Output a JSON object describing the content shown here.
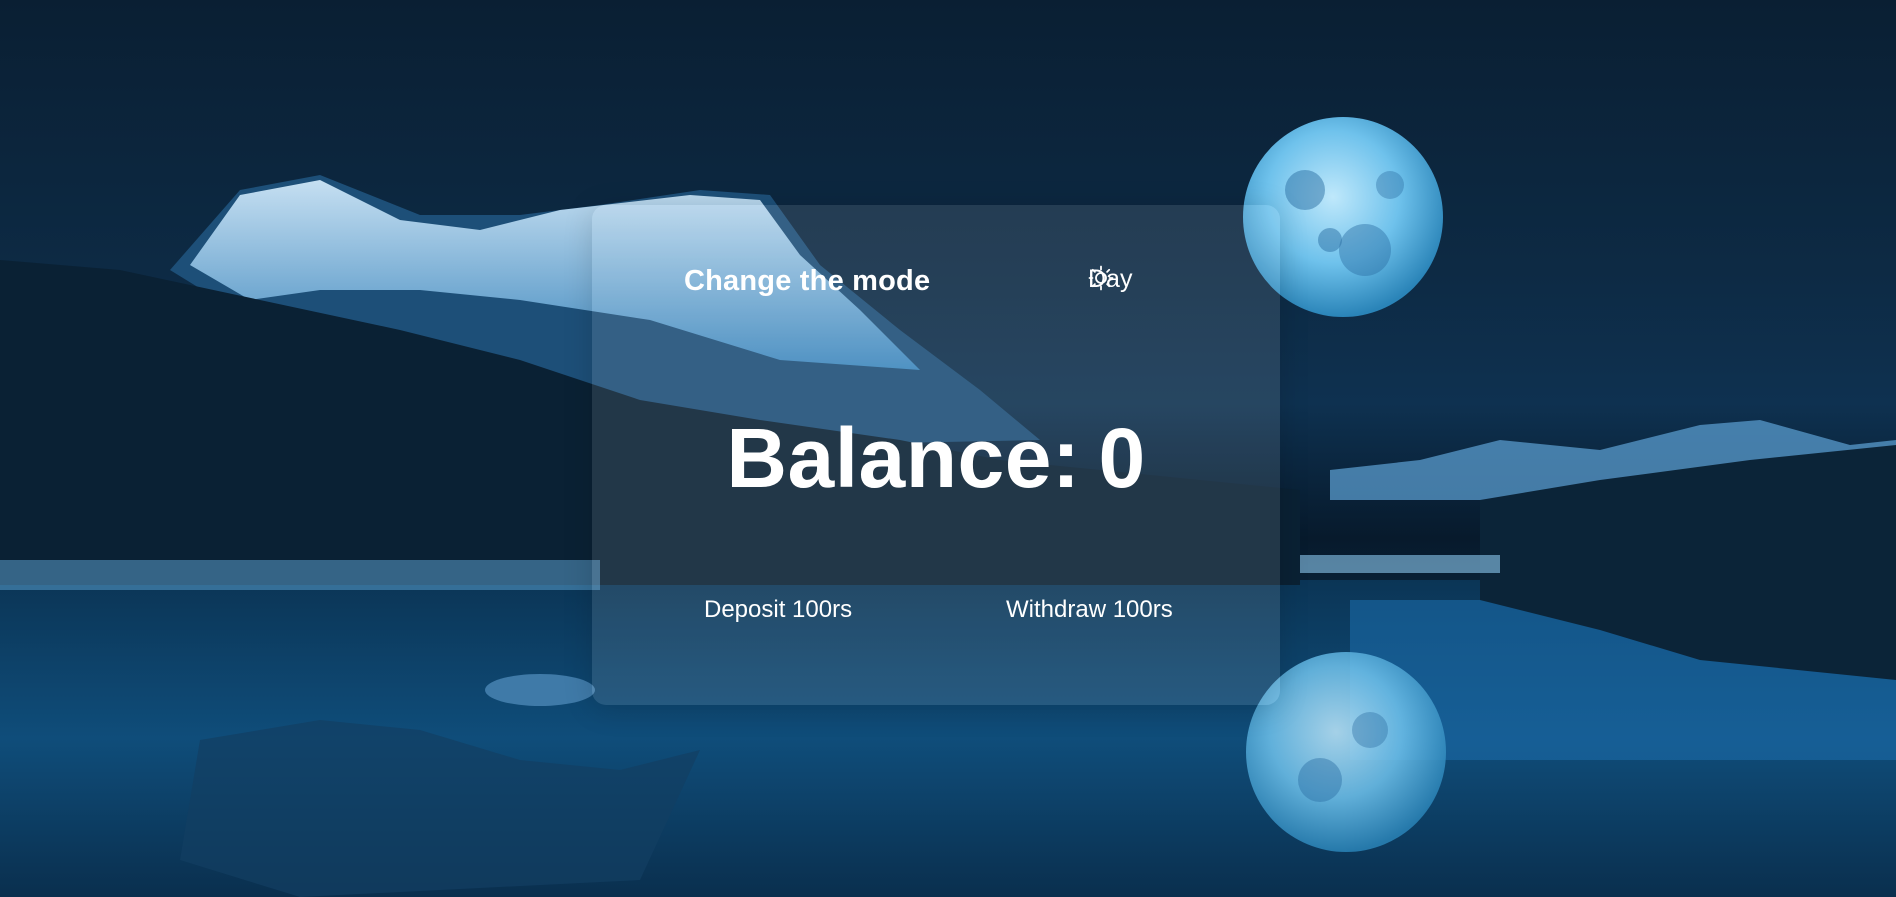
{
  "card": {
    "mode_label": "Change the mode",
    "mode_toggle_label": "Day",
    "mode_toggle_icon": "sun-icon",
    "balance_label": "Balance:",
    "balance_value": "0",
    "deposit_label": "Deposit 100rs",
    "withdraw_label": "Withdraw 100rs"
  },
  "colors": {
    "text": "#ffffff",
    "moon": "#7fd0f5",
    "card_bg": "rgba(255,255,255,0.10)"
  }
}
